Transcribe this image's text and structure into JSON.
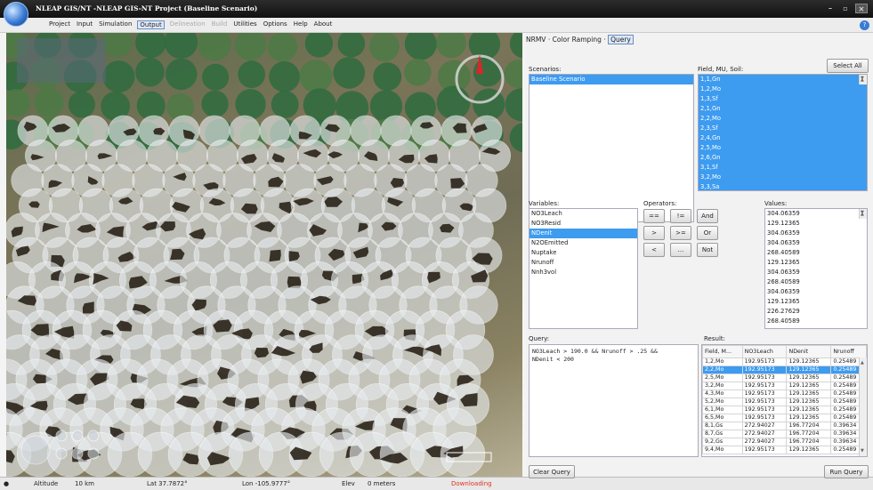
{
  "app": {
    "title": "NLEAP GIS/NT -NLEAP GIS-NT Project (Baseline Scenario)"
  },
  "menu": {
    "items": [
      {
        "label": "Project",
        "state": "normal"
      },
      {
        "label": "Input",
        "state": "normal"
      },
      {
        "label": "Simulation",
        "state": "normal"
      },
      {
        "label": "Output",
        "state": "active"
      },
      {
        "label": "Delineation",
        "state": "disabled"
      },
      {
        "label": "Build",
        "state": "disabled"
      },
      {
        "label": "Utilities",
        "state": "normal"
      },
      {
        "label": "Options",
        "state": "normal"
      },
      {
        "label": "Help",
        "state": "normal"
      },
      {
        "label": "About",
        "state": "normal"
      }
    ]
  },
  "status": {
    "altitude_label": "Altitude",
    "altitude_value": "10 km",
    "lat": "Lat 37.7872°",
    "lon": "Lon -105.9777°",
    "elev_label": "Elev",
    "elev_value": "0 meters",
    "downloading": "Downloading"
  },
  "tabs": {
    "nrmv": "NRMV",
    "sep1": "·",
    "color": "Color Ramping",
    "sep2": "·",
    "query": "Query"
  },
  "scenarios": {
    "label": "Scenarios:",
    "items": [
      "Baseline Scenario"
    ]
  },
  "fields": {
    "label": "Field, MU, Soil:",
    "select_all": "Select All",
    "items": [
      "1,1,Gn",
      "1,2,Mo",
      "1,3,Sf",
      "2,1,Gn",
      "2,2,Mo",
      "2,3,Sf",
      "2,4,Gn",
      "2,5,Mo",
      "2,6,Gn",
      "3,1,Sf",
      "3,2,Mo",
      "3,3,Sa"
    ]
  },
  "variables": {
    "label": "Variables:",
    "items": [
      "NO3Leach",
      "NO3Resid",
      "NDenit",
      "N2OEmitted",
      "Nuptake",
      "Nrunoff",
      "Nnh3vol"
    ],
    "selected_index": 2
  },
  "operators": {
    "label": "Operators:",
    "rows": [
      [
        "==",
        "!=",
        "And"
      ],
      [
        ">",
        ">=",
        "Or"
      ],
      [
        "<",
        "...",
        "Not"
      ]
    ]
  },
  "values": {
    "label": "Values:",
    "items": [
      "304.06359",
      "129.12365",
      "304.06359",
      "304.06359",
      "268.40589",
      "129.12365",
      "304.06359",
      "268.40589",
      "304.06359",
      "129.12365",
      "226.27629",
      "268.40589"
    ]
  },
  "query": {
    "label": "Query:",
    "text": "NO3Leach > 190.0 && Nrunoff > .25 &&\nNDenit < 200"
  },
  "result": {
    "label": "Result:",
    "columns": [
      "Field, M...",
      "NO3Leach",
      "NDenit",
      "Nrunoff"
    ],
    "rows": [
      [
        "1,2,Mo",
        "192.95173",
        "129.12365",
        "0.25489"
      ],
      [
        "2,2,Mo",
        "192.95173",
        "129.12365",
        "0.25489"
      ],
      [
        "2,5,Mo",
        "192.95173",
        "129.12365",
        "0.25489"
      ],
      [
        "3,2,Mo",
        "192.95173",
        "129.12365",
        "0.25489"
      ],
      [
        "4,3,Mo",
        "192.95173",
        "129.12365",
        "0.25489"
      ],
      [
        "5,2,Mo",
        "192.95173",
        "129.12365",
        "0.25489"
      ],
      [
        "6,1,Mo",
        "192.95173",
        "129.12365",
        "0.25489"
      ],
      [
        "6,5,Mo",
        "192.95173",
        "129.12365",
        "0.25489"
      ],
      [
        "8,1,Gs",
        "272.94027",
        "196.77204",
        "0.39634"
      ],
      [
        "8,7,Gs",
        "272.94027",
        "196.77204",
        "0.39634"
      ],
      [
        "9,2,Gs",
        "272.94027",
        "196.77204",
        "0.39634"
      ],
      [
        "9,4,Mo",
        "192.95173",
        "129.12365",
        "0.25489"
      ]
    ],
    "selected_index": 1
  },
  "buttons": {
    "clear_query": "Clear Query",
    "run_query": "Run Query"
  },
  "colors": {
    "selection": "#3d9bf0",
    "downloading": "#e03020"
  }
}
